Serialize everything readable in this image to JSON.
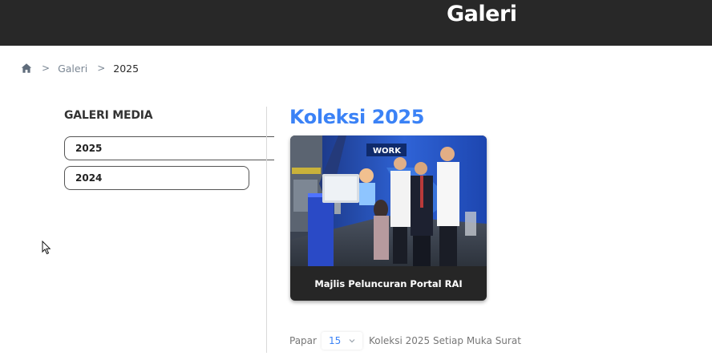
{
  "header": {
    "title": "Galeri"
  },
  "breadcrumb": {
    "home_icon": "home-icon",
    "separator": ">",
    "items": [
      {
        "label": "Galeri"
      },
      {
        "label": "2025"
      }
    ]
  },
  "sidebar": {
    "title": "GALERI MEDIA",
    "items": [
      {
        "label": "2025",
        "active": true
      },
      {
        "label": "2024",
        "active": false
      }
    ]
  },
  "main": {
    "title": "Koleksi 2025",
    "cards": [
      {
        "caption": "Majlis Peluncuran Portal RAI"
      }
    ]
  },
  "pager": {
    "prefix": "Papar",
    "per_page": "15",
    "suffix": "Koleksi 2025 Setiap Muka Surat"
  },
  "colors": {
    "header_bg": "#282828",
    "accent": "#3b82f6",
    "card_caption_bg": "#262626"
  }
}
